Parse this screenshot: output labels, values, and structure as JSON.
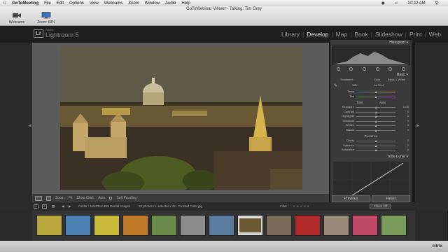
{
  "menubar": {
    "apple": "",
    "app": "GoToMeeting",
    "items": [
      "File",
      "Edit",
      "Options",
      "View",
      "Webcams",
      "Zoom",
      "Window",
      "Audio",
      "Help"
    ],
    "clock": "10:42 AM"
  },
  "viewer": {
    "title": "GoToWebinar Viewer - Talking: Tim Grey",
    "webcams_label": "Webcams",
    "zoom_label": "Zoom: 69%"
  },
  "lightroom": {
    "adobe": "Adobe",
    "product": "Lightroom 5",
    "logo": "Lr",
    "modules": [
      "Library",
      "Develop",
      "Map",
      "Book",
      "Slideshow",
      "Print",
      "Web"
    ],
    "active_module": "Develop"
  },
  "toolbar": {
    "zoom_label": "Zoom",
    "fit_label": "Fit",
    "grid_label": "Show Grid:",
    "grid_value": "Auto",
    "soft_proofing": "Soft Proofing"
  },
  "panel": {
    "histogram_title": "Histogram",
    "basic_title": "Basic",
    "treatment_label": "Treatment :",
    "color_label": "Color",
    "bw_label": "Black & White",
    "wb_label": "WB :",
    "wb_value": "As Shot",
    "temp": {
      "label": "Temp",
      "value": "",
      "pos": 0.5
    },
    "tint": {
      "label": "Tint",
      "value": "",
      "pos": 0.5
    },
    "tone_title": "Tone",
    "tone_auto": "Auto",
    "tone_rows": [
      {
        "label": "Exposure",
        "value": "0.00",
        "pos": 0.5
      },
      {
        "label": "Contrast",
        "value": "0",
        "pos": 0.5
      },
      {
        "label": "Highlights",
        "value": "0",
        "pos": 0.5
      },
      {
        "label": "Shadows",
        "value": "0",
        "pos": 0.5
      },
      {
        "label": "Whites",
        "value": "0",
        "pos": 0.5
      },
      {
        "label": "Blacks",
        "value": "0",
        "pos": 0.5
      }
    ],
    "presence_title": "Presence",
    "presence_rows": [
      {
        "label": "Clarity",
        "value": "0",
        "pos": 0.5
      },
      {
        "label": "Vibrance",
        "value": "0",
        "pos": 0.5
      },
      {
        "label": "Saturation",
        "value": "0",
        "pos": 0.5
      }
    ],
    "tone_curve_title": "Tone Curve",
    "previous_label": "Previous",
    "reset_label": "Reset"
  },
  "filmstrip": {
    "page1": "1",
    "page2": "2",
    "path": "Folder : MacPhun BW Dental Images",
    "count": "20 photos / 1 selected / 02 - Fix Bad Color.jpg",
    "filter_label": "Filter :",
    "filters_off": "Filters Off",
    "thumbnails": [
      {
        "name": "yellow-grapes",
        "color": "#b8a63a"
      },
      {
        "name": "tree-sky",
        "color": "#4a7fb0"
      },
      {
        "name": "yellow-pattern",
        "color": "#c9b93a"
      },
      {
        "name": "sunset-trees",
        "color": "#c07a2a"
      },
      {
        "name": "landscape-field",
        "color": "#6a8a4a"
      },
      {
        "name": "gray-scene",
        "color": "#8a8a8a"
      },
      {
        "name": "blue-sky",
        "color": "#5a7aa0"
      },
      {
        "name": "rome-night",
        "color": "#6b5a32"
      },
      {
        "name": "wood-interior",
        "color": "#7a6a5a"
      },
      {
        "name": "red-car",
        "color": "#b02a2a"
      },
      {
        "name": "cat",
        "color": "#9a8a7a"
      },
      {
        "name": "pink-car",
        "color": "#c04a6a"
      },
      {
        "name": "goat-field",
        "color": "#7a9a5a"
      }
    ]
  },
  "footer": {
    "brand": "citrix"
  }
}
